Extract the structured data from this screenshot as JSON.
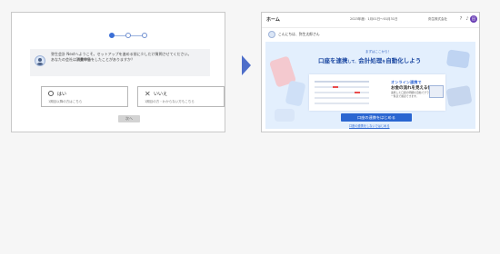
{
  "setup_screen": {
    "steps": [
      {
        "state": "active"
      },
      {
        "state": "inactive"
      },
      {
        "state": "inactive"
      }
    ],
    "message_line1": "弥生会計 Nextへようこそ。セットアップを進める前に少しだけ質問させてください。",
    "message_line2_prefix": "あなたの会社は",
    "message_line2_bold": "消費申告",
    "message_line2_suffix": "をしたことがありますか？",
    "choices": [
      {
        "label": "はい",
        "sub": "1期目以降の方はこちら",
        "icon": "circle-icon"
      },
      {
        "label": "いいえ",
        "sub": "1期目の方・わからない方もこちら",
        "icon": "cross-icon"
      }
    ],
    "next_label": "次へ"
  },
  "home_screen": {
    "logo": "ホーム",
    "date_range": "2023年度：1月01日～01月31日",
    "company": "弥生株式会社",
    "header_icons": [
      "help-icon",
      "bell-icon"
    ],
    "user_initial": "田",
    "greeting": "こんにちは、弥生太郎さん",
    "banner": {
      "kicker": "まずはここから！",
      "headline_a": "口座を連携",
      "headline_b": "して、",
      "headline_c": "会計処理",
      "headline_d": "を",
      "headline_e": "自動化しよう",
      "online_title": "オンライン連携で",
      "online_head": "お金の流れを見える化！",
      "online_note_1": "連携した口座の明細を自動でグラフや",
      "online_note_2": "一覧表で確認できます。",
      "cta": "口座の連携をはじめる",
      "skip": "口座の連携をしないではじめる"
    }
  },
  "colors": {
    "accent": "#2a66d1",
    "arrow": "#4e6ec9",
    "banner_bg": "#e3effd",
    "warn": "#e84c4c"
  }
}
